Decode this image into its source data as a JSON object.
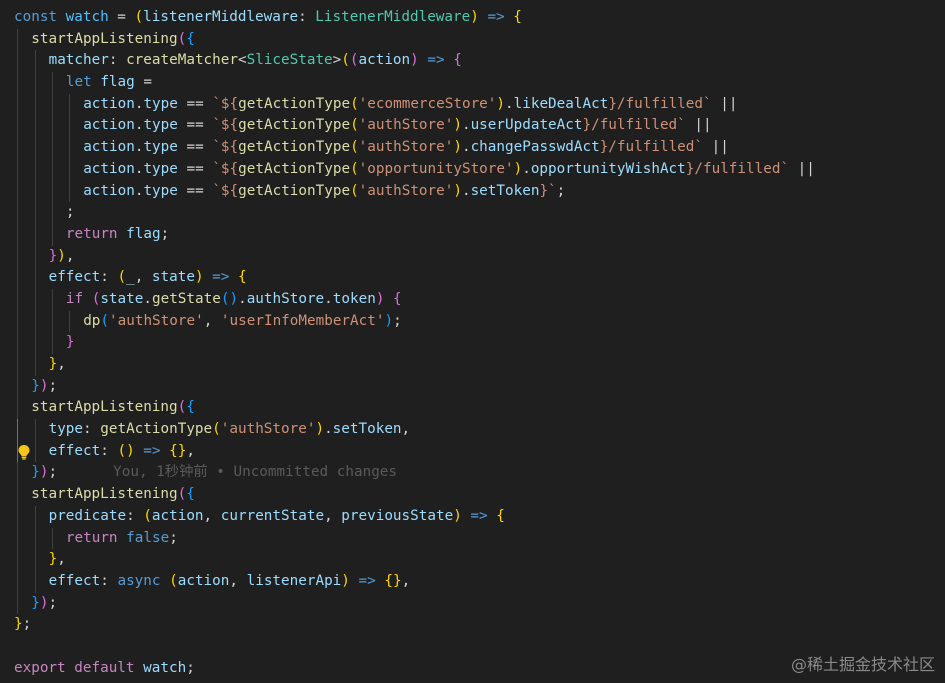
{
  "editor": {
    "language": "typescript",
    "theme": "dark",
    "lines": [
      {
        "tokens": [
          [
            "const",
            "kw"
          ],
          [
            " ",
            "op"
          ],
          [
            "watch",
            "const"
          ],
          [
            " = ",
            "op"
          ],
          [
            "(",
            "b1"
          ],
          [
            "listenerMiddleware",
            "var"
          ],
          [
            ": ",
            "op"
          ],
          [
            "ListenerMiddleware",
            "type"
          ],
          [
            ")",
            "b1"
          ],
          [
            " ",
            "op"
          ],
          [
            "=>",
            "kw"
          ],
          [
            " ",
            "op"
          ],
          [
            "{",
            "b1"
          ]
        ]
      },
      {
        "tokens": [
          [
            "startAppListening",
            "fn"
          ],
          [
            "(",
            "b2"
          ],
          [
            "{",
            "b3"
          ]
        ]
      },
      {
        "tokens": [
          [
            "matcher",
            "var"
          ],
          [
            ": ",
            "op"
          ],
          [
            "createMatcher",
            "fn"
          ],
          [
            "<",
            "op"
          ],
          [
            "SliceState",
            "type"
          ],
          [
            ">",
            "op"
          ],
          [
            "(",
            "b1"
          ],
          [
            "(",
            "b2"
          ],
          [
            "action",
            "var"
          ],
          [
            ")",
            "b2"
          ],
          [
            " ",
            "op"
          ],
          [
            "=>",
            "kw"
          ],
          [
            " ",
            "op"
          ],
          [
            "{",
            "b2"
          ]
        ]
      },
      {
        "tokens": [
          [
            "let",
            "kw"
          ],
          [
            " ",
            "op"
          ],
          [
            "flag",
            "var"
          ],
          [
            " =",
            "op"
          ]
        ]
      },
      {
        "tokens": [
          [
            "action",
            "var"
          ],
          [
            ".",
            "op"
          ],
          [
            "type",
            "var"
          ],
          [
            " == ",
            "op"
          ],
          [
            "`${",
            "str"
          ],
          [
            "getActionType",
            "fn"
          ],
          [
            "(",
            "b1"
          ],
          [
            "'ecommerceStore'",
            "str"
          ],
          [
            ")",
            "b1"
          ],
          [
            ".",
            "op"
          ],
          [
            "likeDealAct",
            "var"
          ],
          [
            "}/fulfilled`",
            "str"
          ],
          [
            " ||",
            "op"
          ]
        ]
      },
      {
        "tokens": [
          [
            "action",
            "var"
          ],
          [
            ".",
            "op"
          ],
          [
            "type",
            "var"
          ],
          [
            " == ",
            "op"
          ],
          [
            "`${",
            "str"
          ],
          [
            "getActionType",
            "fn"
          ],
          [
            "(",
            "b1"
          ],
          [
            "'authStore'",
            "str"
          ],
          [
            ")",
            "b1"
          ],
          [
            ".",
            "op"
          ],
          [
            "userUpdateAct",
            "var"
          ],
          [
            "}/fulfilled`",
            "str"
          ],
          [
            " ||",
            "op"
          ]
        ]
      },
      {
        "tokens": [
          [
            "action",
            "var"
          ],
          [
            ".",
            "op"
          ],
          [
            "type",
            "var"
          ],
          [
            " == ",
            "op"
          ],
          [
            "`${",
            "str"
          ],
          [
            "getActionType",
            "fn"
          ],
          [
            "(",
            "b1"
          ],
          [
            "'authStore'",
            "str"
          ],
          [
            ")",
            "b1"
          ],
          [
            ".",
            "op"
          ],
          [
            "changePasswdAct",
            "var"
          ],
          [
            "}/fulfilled`",
            "str"
          ],
          [
            " ||",
            "op"
          ]
        ]
      },
      {
        "tokens": [
          [
            "action",
            "var"
          ],
          [
            ".",
            "op"
          ],
          [
            "type",
            "var"
          ],
          [
            " == ",
            "op"
          ],
          [
            "`${",
            "str"
          ],
          [
            "getActionType",
            "fn"
          ],
          [
            "(",
            "b1"
          ],
          [
            "'opportunityStore'",
            "str"
          ],
          [
            ")",
            "b1"
          ],
          [
            ".",
            "op"
          ],
          [
            "opportunityWishAct",
            "var"
          ],
          [
            "}/fulfilled`",
            "str"
          ],
          [
            " ||",
            "op"
          ]
        ]
      },
      {
        "tokens": [
          [
            "action",
            "var"
          ],
          [
            ".",
            "op"
          ],
          [
            "type",
            "var"
          ],
          [
            " == ",
            "op"
          ],
          [
            "`${",
            "str"
          ],
          [
            "getActionType",
            "fn"
          ],
          [
            "(",
            "b1"
          ],
          [
            "'authStore'",
            "str"
          ],
          [
            ")",
            "b1"
          ],
          [
            ".",
            "op"
          ],
          [
            "setToken",
            "var"
          ],
          [
            "}`",
            "str"
          ],
          [
            ";",
            "op"
          ]
        ]
      },
      {
        "tokens": [
          [
            ";",
            "op"
          ]
        ]
      },
      {
        "tokens": [
          [
            "return",
            "ctl"
          ],
          [
            " ",
            "op"
          ],
          [
            "flag",
            "var"
          ],
          [
            ";",
            "op"
          ]
        ]
      },
      {
        "tokens": [
          [
            "}",
            "b2"
          ],
          [
            ")",
            "b1"
          ],
          [
            ",",
            "op"
          ]
        ]
      },
      {
        "tokens": [
          [
            "effect",
            "var"
          ],
          [
            ": ",
            "op"
          ],
          [
            "(",
            "b1"
          ],
          [
            "_",
            "var"
          ],
          [
            ", ",
            "op"
          ],
          [
            "state",
            "var"
          ],
          [
            ")",
            "b1"
          ],
          [
            " ",
            "op"
          ],
          [
            "=>",
            "kw"
          ],
          [
            " ",
            "op"
          ],
          [
            "{",
            "b1"
          ]
        ]
      },
      {
        "tokens": [
          [
            "if",
            "ctl"
          ],
          [
            " ",
            "op"
          ],
          [
            "(",
            "b2"
          ],
          [
            "state",
            "var"
          ],
          [
            ".",
            "op"
          ],
          [
            "getState",
            "fn"
          ],
          [
            "(",
            "b3"
          ],
          [
            ")",
            "b3"
          ],
          [
            ".",
            "op"
          ],
          [
            "authStore",
            "var"
          ],
          [
            ".",
            "op"
          ],
          [
            "token",
            "var"
          ],
          [
            ")",
            "b2"
          ],
          [
            " ",
            "op"
          ],
          [
            "{",
            "b2"
          ]
        ]
      },
      {
        "tokens": [
          [
            "dp",
            "fn"
          ],
          [
            "(",
            "b3"
          ],
          [
            "'authStore'",
            "str"
          ],
          [
            ", ",
            "op"
          ],
          [
            "'userInfoMemberAct'",
            "str"
          ],
          [
            ")",
            "b3"
          ],
          [
            ";",
            "op"
          ]
        ]
      },
      {
        "tokens": [
          [
            "}",
            "b2"
          ]
        ]
      },
      {
        "tokens": [
          [
            "}",
            "b1"
          ],
          [
            ",",
            "op"
          ]
        ]
      },
      {
        "tokens": [
          [
            "}",
            "b3"
          ],
          [
            ")",
            "b2"
          ],
          [
            ";",
            "op"
          ]
        ]
      },
      {
        "tokens": [
          [
            "startAppListening",
            "fn"
          ],
          [
            "(",
            "b2"
          ],
          [
            "{",
            "b3"
          ]
        ]
      },
      {
        "tokens": [
          [
            "type",
            "var"
          ],
          [
            ": ",
            "op"
          ],
          [
            "getActionType",
            "fn"
          ],
          [
            "(",
            "b1"
          ],
          [
            "'authStore'",
            "str"
          ],
          [
            ")",
            "b1"
          ],
          [
            ".",
            "op"
          ],
          [
            "setToken",
            "var"
          ],
          [
            ",",
            "op"
          ]
        ]
      },
      {
        "tokens": [
          [
            "effect",
            "var"
          ],
          [
            ": ",
            "op"
          ],
          [
            "(",
            "b1"
          ],
          [
            ")",
            "b1"
          ],
          [
            " ",
            "op"
          ],
          [
            "=>",
            "kw"
          ],
          [
            " ",
            "op"
          ],
          [
            "{",
            "b1"
          ],
          [
            "}",
            "b1"
          ],
          [
            ",",
            "op"
          ]
        ]
      },
      {
        "tokens": [
          [
            "}",
            "b3"
          ],
          [
            ")",
            "b2"
          ],
          [
            ";",
            "op"
          ]
        ],
        "blame": "You, 1秒钟前 • Uncommitted changes"
      },
      {
        "tokens": [
          [
            "startAppListening",
            "fn"
          ],
          [
            "(",
            "b2"
          ],
          [
            "{",
            "b3"
          ]
        ]
      },
      {
        "tokens": [
          [
            "predicate",
            "var"
          ],
          [
            ": ",
            "op"
          ],
          [
            "(",
            "b1"
          ],
          [
            "action",
            "var"
          ],
          [
            ", ",
            "op"
          ],
          [
            "currentState",
            "var"
          ],
          [
            ", ",
            "op"
          ],
          [
            "previousState",
            "var"
          ],
          [
            ")",
            "b1"
          ],
          [
            " ",
            "op"
          ],
          [
            "=>",
            "kw"
          ],
          [
            " ",
            "op"
          ],
          [
            "{",
            "b1"
          ]
        ]
      },
      {
        "tokens": [
          [
            "return",
            "ctl"
          ],
          [
            " ",
            "op"
          ],
          [
            "false",
            "kw"
          ],
          [
            ";",
            "op"
          ]
        ]
      },
      {
        "tokens": [
          [
            "}",
            "b1"
          ],
          [
            ",",
            "op"
          ]
        ]
      },
      {
        "tokens": [
          [
            "effect",
            "var"
          ],
          [
            ": ",
            "op"
          ],
          [
            "async",
            "kw"
          ],
          [
            " ",
            "op"
          ],
          [
            "(",
            "b1"
          ],
          [
            "action",
            "var"
          ],
          [
            ", ",
            "op"
          ],
          [
            "listenerApi",
            "var"
          ],
          [
            ")",
            "b1"
          ],
          [
            " ",
            "op"
          ],
          [
            "=>",
            "kw"
          ],
          [
            " ",
            "op"
          ],
          [
            "{",
            "b1"
          ],
          [
            "}",
            "b1"
          ],
          [
            ",",
            "op"
          ]
        ]
      },
      {
        "tokens": [
          [
            "}",
            "b3"
          ],
          [
            ")",
            "b2"
          ],
          [
            ";",
            "op"
          ]
        ]
      },
      {
        "tokens": [
          [
            "}",
            "b1"
          ],
          [
            ";",
            "op"
          ]
        ]
      },
      {
        "tokens": []
      },
      {
        "tokens": [
          [
            "export",
            "ctl"
          ],
          [
            " ",
            "op"
          ],
          [
            "default",
            "ctl"
          ],
          [
            " ",
            "op"
          ],
          [
            "watch",
            "var"
          ],
          [
            ";",
            "op"
          ]
        ]
      }
    ]
  },
  "icons": {
    "lightbulb": "lightbulb-icon"
  },
  "watermark": "@稀土掘金技术社区"
}
